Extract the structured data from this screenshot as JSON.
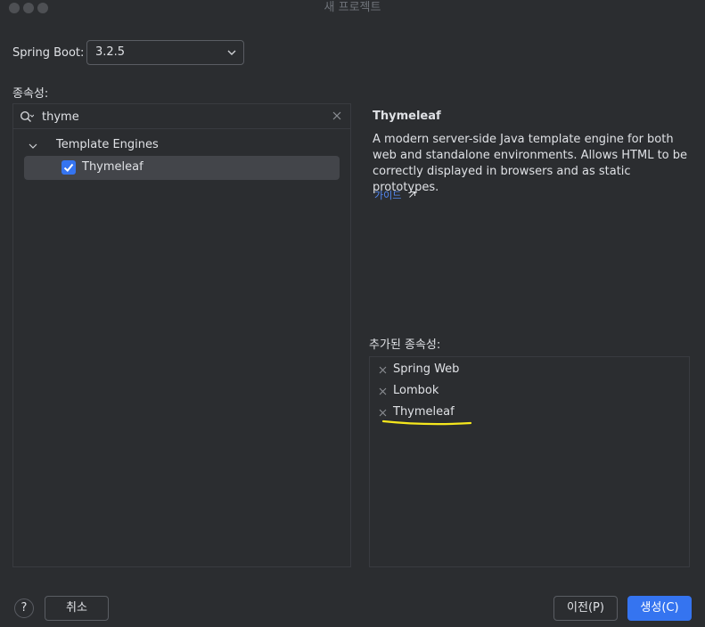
{
  "window": {
    "title": "새 프로젝트"
  },
  "spring_boot": {
    "label": "Spring Boot:",
    "value": "3.2.5"
  },
  "dependencies": {
    "label": "종속성:",
    "search": {
      "value": "thyme"
    },
    "groups": [
      {
        "label": "Template Engines",
        "items": [
          {
            "label": "Thymeleaf",
            "checked": true
          }
        ]
      }
    ]
  },
  "detail": {
    "title": "Thymeleaf",
    "description": "A modern server-side Java template engine for both web and standalone environments. Allows HTML to be correctly displayed in browsers and as static prototypes.",
    "guide_link": "가이드"
  },
  "added": {
    "label": "추가된 종속성:",
    "items": [
      "Spring Web",
      "Lombok",
      "Thymeleaf"
    ]
  },
  "footer": {
    "help": "?",
    "cancel": "취소",
    "previous": "이전(P)",
    "create": "생성(C)"
  },
  "colors": {
    "accent": "#3574f0",
    "link": "#548af7",
    "highlight_underline": "#f5e71d",
    "background": "#2b2d30"
  }
}
